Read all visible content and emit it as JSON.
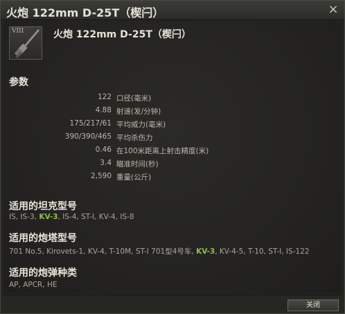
{
  "window": {
    "title": "火炮 122mm D-25T（楔闩）",
    "close_glyph": "×"
  },
  "module": {
    "tier": "VIII",
    "name": "火炮 122mm D-25T（楔闩）",
    "icon": "gun-barrel-icon"
  },
  "params": {
    "heading": "参数",
    "rows": [
      {
        "value": "122",
        "label": "口径(毫米)"
      },
      {
        "value": "4.88",
        "label": "射速(发/分钟)"
      },
      {
        "value": "175/217/61",
        "label": "平均威力(毫米)"
      },
      {
        "value": "390/390/465",
        "label": "平均杀伤力"
      },
      {
        "value": "0.46",
        "label": "在100米距离上射击精度(米)"
      },
      {
        "value": "3.4",
        "label": "瞄准时间(秒)"
      },
      {
        "value": "2,590",
        "label": "重量(公斤)"
      }
    ]
  },
  "compat_tanks": {
    "heading": "适用的坦克型号",
    "before": "IS, IS-3, ",
    "highlight": "KV-3",
    "after": ", IS-4, ST-I, KV-4, IS-8"
  },
  "compat_turrets": {
    "heading": "适用的炮塔型号",
    "before": "701 No.5, Kirovets-1, KV-4, T-10M, ST-I 701型4号车, ",
    "highlight": "KV-3",
    "after": ", KV-4-5, T-10, ST-I, IS-122"
  },
  "compat_shells": {
    "heading": "适用的炮弹种类",
    "text": "AP, APCR, HE"
  },
  "footer": {
    "close_label": "关闭"
  },
  "colors": {
    "highlight": "#8fbf4a",
    "background": "#242421"
  }
}
